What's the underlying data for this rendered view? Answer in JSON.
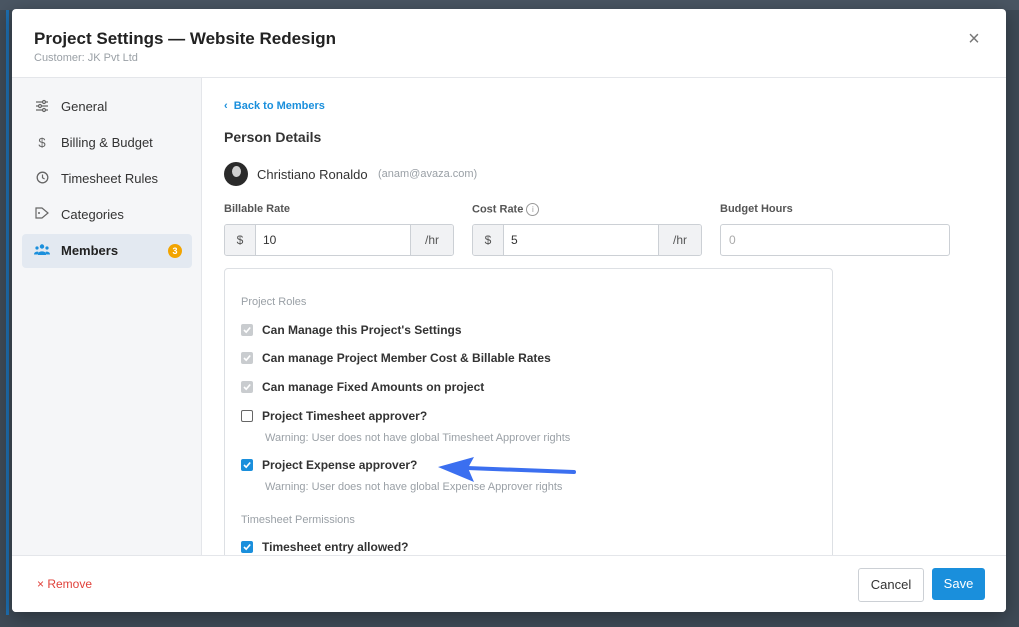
{
  "modal": {
    "title": "Project Settings — Website Redesign",
    "subtitle": "Customer: JK Pvt Ltd",
    "close_icon": "×"
  },
  "sidebar": {
    "items": [
      {
        "label": "General",
        "icon": "sliders-icon"
      },
      {
        "label": "Billing & Budget",
        "icon": "dollar-icon"
      },
      {
        "label": "Timesheet Rules",
        "icon": "clock-icon"
      },
      {
        "label": "Categories",
        "icon": "tag-icon"
      },
      {
        "label": "Members",
        "icon": "users-icon",
        "badge": "3",
        "active": true
      }
    ]
  },
  "content": {
    "back_link": "Back to Members",
    "section_title": "Person Details",
    "person": {
      "name": "Christiano Ronaldo",
      "email": "(anam@avaza.com)"
    },
    "fields": {
      "billable": {
        "label": "Billable Rate",
        "prefix": "$",
        "value": "10",
        "suffix": "/hr"
      },
      "cost": {
        "label": "Cost Rate",
        "prefix": "$",
        "value": "5",
        "suffix": "/hr",
        "info": "i"
      },
      "budget": {
        "label": "Budget Hours",
        "placeholder": "0"
      }
    },
    "project_roles": {
      "label": "Project Roles",
      "items": [
        {
          "label": "Can Manage this Project's Settings",
          "state": "checked-disabled"
        },
        {
          "label": "Can manage Project Member Cost & Billable Rates",
          "state": "checked-disabled"
        },
        {
          "label": "Can manage Fixed Amounts on project",
          "state": "checked-disabled"
        },
        {
          "label": "Project Timesheet approver?",
          "state": "unchecked",
          "warning": "Warning: User does not have global Timesheet Approver rights"
        },
        {
          "label": "Project Expense approver?",
          "state": "checked",
          "warning": "Warning: User does not have global Expense Approver rights"
        }
      ]
    },
    "timesheet_permissions": {
      "label": "Timesheet Permissions",
      "items": [
        {
          "label": "Timesheet entry allowed?",
          "state": "checked"
        }
      ]
    }
  },
  "footer": {
    "remove_label": "× Remove",
    "cancel_label": "Cancel",
    "save_label": "Save"
  },
  "colors": {
    "accent": "#1a8fdc",
    "danger": "#e0413a",
    "badge": "#f2a400",
    "annotation_arrow": "#3b6ff0"
  }
}
